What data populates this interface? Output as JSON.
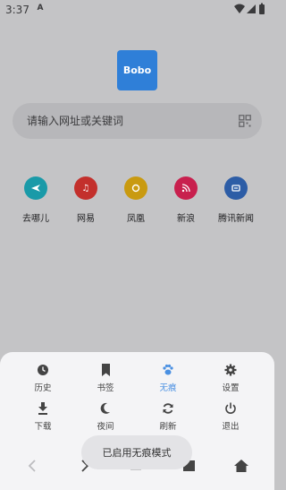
{
  "status_bar": {
    "time": "3:37",
    "sim": "A"
  },
  "logo": {
    "text": "Bobo"
  },
  "search": {
    "placeholder": "请输入网址或关键词"
  },
  "quick_sites": [
    {
      "label": "去哪儿",
      "color": "#1a9aa8",
      "icon": "plane-icon"
    },
    {
      "label": "网易",
      "color": "#c3302c",
      "icon": "music-icon"
    },
    {
      "label": "凤凰",
      "color": "#c99a10",
      "icon": "phoenix-icon"
    },
    {
      "label": "新浪",
      "color": "#c8204e",
      "icon": "rss-icon"
    },
    {
      "label": "腾讯新闻",
      "color": "#2d5da6",
      "icon": "news-icon"
    }
  ],
  "menu": {
    "row1": [
      {
        "label": "历史",
        "icon": "clock-icon"
      },
      {
        "label": "书签",
        "icon": "bookmark-icon"
      },
      {
        "label": "无痕",
        "icon": "paw-icon",
        "active": true
      },
      {
        "label": "设置",
        "icon": "gear-icon"
      }
    ],
    "row2": [
      {
        "label": "下载",
        "icon": "download-icon"
      },
      {
        "label": "夜间",
        "icon": "moon-icon"
      },
      {
        "label": "刷新",
        "icon": "refresh-icon"
      },
      {
        "label": "退出",
        "icon": "power-icon"
      }
    ]
  },
  "toast": {
    "text": "已启用无痕模式"
  },
  "colors": {
    "accent": "#4a90e2",
    "logo_bg": "#2f7fd8"
  }
}
